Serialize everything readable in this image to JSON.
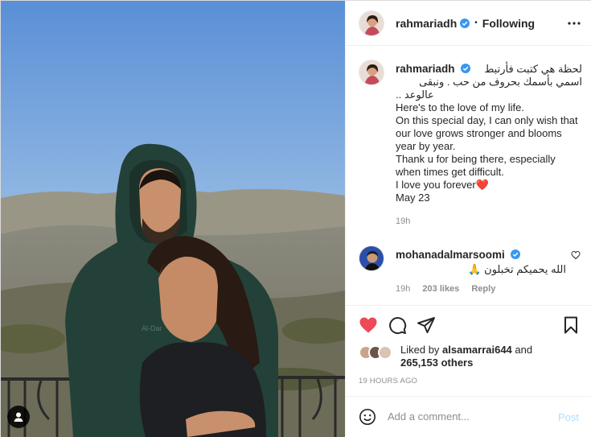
{
  "post": {
    "username": "rahmariadh",
    "follow_state": "Following",
    "dot": "•"
  },
  "caption": {
    "username": "rahmariadh",
    "arabic_line_1": "لحظة هي كتبت فأرتبط",
    "arabic_line_2": "اسمي بأسمك بحروف من حب . ونبقى",
    "arabic_line_3": "عالوعد ..",
    "lines": [
      "Here's to the love of my life.",
      "On this special day, I can only wish that our love grows stronger and blooms year by year.",
      "Thank u for being there, especially when times get difficult.",
      "I love you forever❤️",
      "May 23"
    ],
    "time": "19h"
  },
  "comment": {
    "username": "mohanadalmarsoomi",
    "text": "الله يحميكم تخبلون 🙏",
    "time": "19h",
    "likes": "203 likes",
    "reply": "Reply"
  },
  "likes": {
    "prefix": "Liked by",
    "user": "alsamarrai644",
    "middle": "and",
    "others": "265,153 others"
  },
  "timestamp": "19 HOURS AGO",
  "composer": {
    "placeholder": "Add a comment...",
    "post_label": "Post"
  },
  "icons": {
    "liked_heart_color": "#ed4956",
    "verified_color": "#3897f0"
  }
}
